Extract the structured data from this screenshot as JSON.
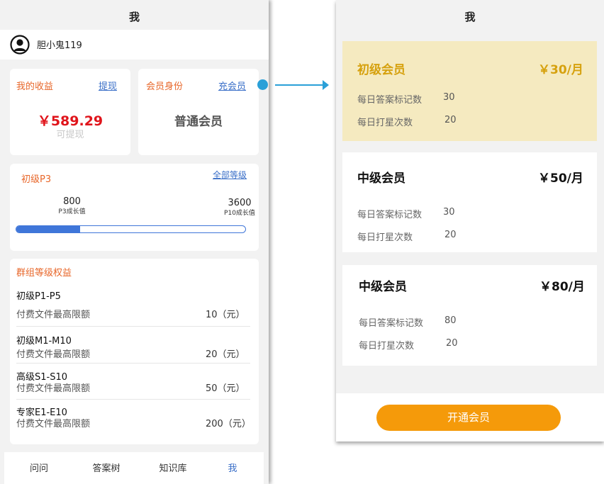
{
  "left": {
    "header_title": "我",
    "username": "胆小鬼119",
    "earnings": {
      "label": "我的收益",
      "withdraw_link": "提现",
      "amount": "￥589.29",
      "sub": "可提现"
    },
    "membership": {
      "label": "会员身份",
      "recharge_link": "充会员",
      "type": "普通会员"
    },
    "level": {
      "name": "初级P3",
      "all_link": "全部等级",
      "current_value": "800",
      "current_label": "P3成长值",
      "target_value": "3600",
      "target_label": "P10成长值",
      "progress_fraction": 0.2778
    },
    "benefits": {
      "title": "群组等级权益",
      "tiers": [
        {
          "name": "初级P1-P5",
          "limit_label": "付费文件最高限额",
          "limit_value": "10（元）"
        },
        {
          "name": "初级M1-M10",
          "limit_label": "付费文件最高限额",
          "limit_value": "20（元）"
        },
        {
          "name": "高级S1-S10",
          "limit_label": "付费文件最高限额",
          "limit_value": "50（元）"
        },
        {
          "name": "专家E1-E10",
          "limit_label": "付费文件最高限额",
          "limit_value": "200（元）"
        }
      ]
    },
    "nav": [
      {
        "label": "问问",
        "active": false
      },
      {
        "label": "答案树",
        "active": false
      },
      {
        "label": "知识库",
        "active": false
      },
      {
        "label": "我",
        "active": true
      }
    ]
  },
  "right": {
    "header_title": "我",
    "plans": [
      {
        "title": "初级会员",
        "price": "￥30/月",
        "highlight": true,
        "rows": [
          {
            "label": "每日答案标记数",
            "value": "30"
          },
          {
            "label": "每日打星次数",
            "value": "20"
          }
        ]
      },
      {
        "title": "中级会员",
        "price": "￥50/月",
        "highlight": false,
        "rows": [
          {
            "label": "每日答案标记数",
            "value": "30"
          },
          {
            "label": "每日打星次数",
            "value": "20"
          }
        ]
      },
      {
        "title": "中级会员",
        "price": "￥80/月",
        "highlight": false,
        "rows": [
          {
            "label": "每日答案标记数",
            "value": "80"
          },
          {
            "label": "每日打星次数",
            "value": "20"
          }
        ]
      }
    ],
    "cta": "开通会员"
  },
  "colors": {
    "accent_orange": "#f59a0a",
    "link_blue": "#3a6fc8",
    "highlight_bg": "#f5eac0",
    "highlight_text": "#d6a10e",
    "amount_red": "#e0141b",
    "connector": "#2aa0d8"
  }
}
